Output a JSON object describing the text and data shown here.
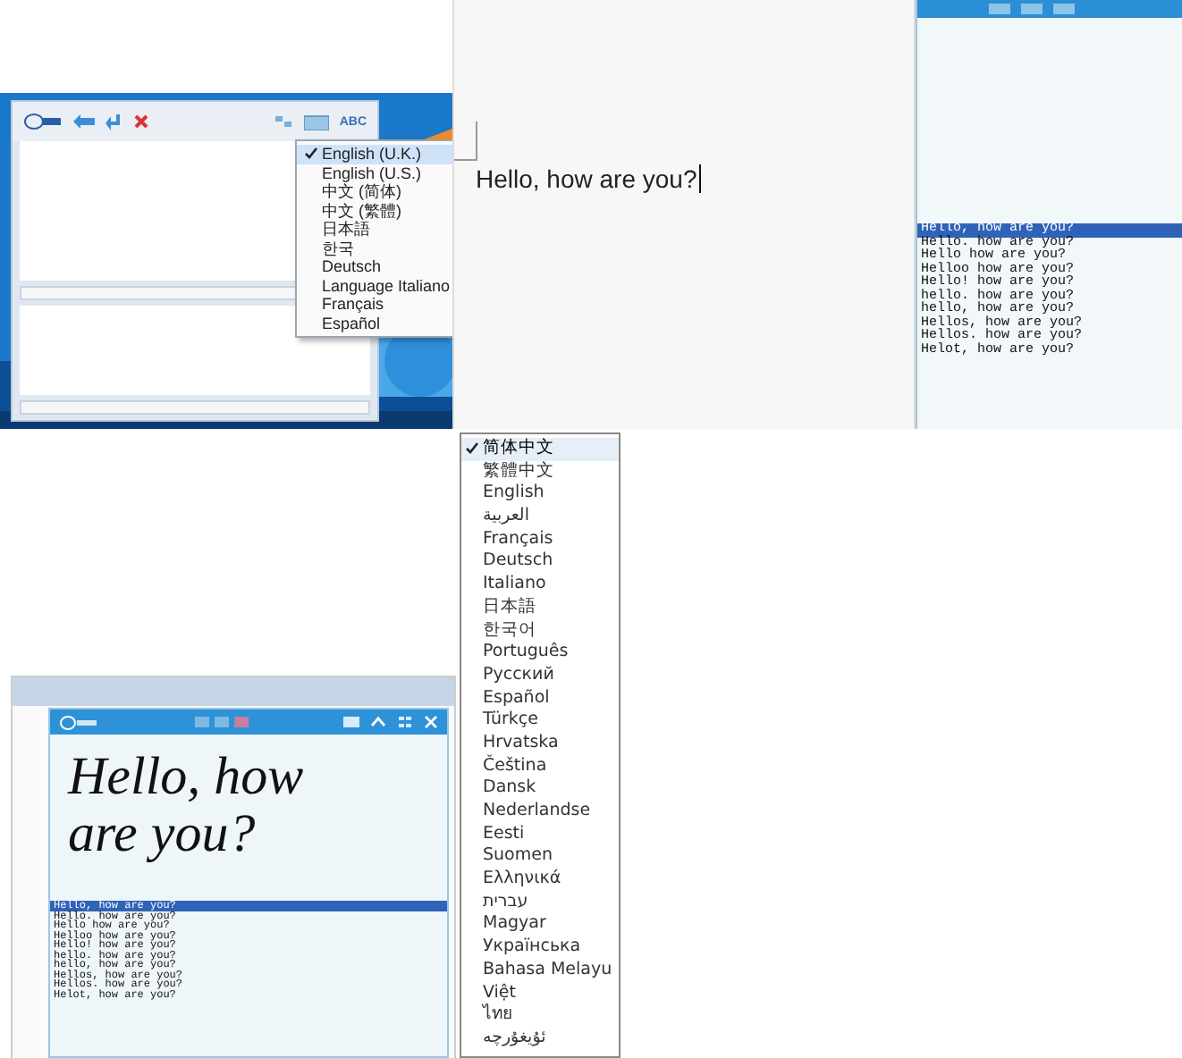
{
  "desktop_app": {
    "toolbar_label": "ABC",
    "language_menu": [
      {
        "label": "English (U.K.)",
        "selected": true
      },
      {
        "label": "English (U.S.)",
        "selected": false
      },
      {
        "label": "中文 (简体)",
        "selected": false
      },
      {
        "label": "中文 (繁體)",
        "selected": false
      },
      {
        "label": "日本語",
        "selected": false
      },
      {
        "label": "한국",
        "selected": false
      },
      {
        "label": "Deutsch",
        "selected": false
      },
      {
        "label": "Language Italiano",
        "selected": false
      },
      {
        "label": "Français",
        "selected": false
      },
      {
        "label": "Español",
        "selected": false
      }
    ]
  },
  "document": {
    "text": "Hello, how are you?"
  },
  "side_app": {
    "candidates": [
      {
        "text": "Hello, how are you?",
        "selected": true
      },
      {
        "text": "Hello. how are you?",
        "selected": false
      },
      {
        "text": "Hello how are you?",
        "selected": false
      },
      {
        "text": "Helloo how are you?",
        "selected": false
      },
      {
        "text": "Hello! how are you?",
        "selected": false
      },
      {
        "text": "hello. how are you?",
        "selected": false
      },
      {
        "text": "hello, how are you?",
        "selected": false
      },
      {
        "text": "Hellos, how are you?",
        "selected": false
      },
      {
        "text": "Hellos. how are you?",
        "selected": false
      },
      {
        "text": "Helot, how are you?",
        "selected": false
      }
    ]
  },
  "handwriting_app": {
    "ink": "Hello, how are you?",
    "candidates": [
      {
        "text": "Hello, how are you?",
        "selected": true
      },
      {
        "text": "Hello. how are you?",
        "selected": false
      },
      {
        "text": "Hello how are you?",
        "selected": false
      },
      {
        "text": "Helloo how are you?",
        "selected": false
      },
      {
        "text": "Hello! how are you?",
        "selected": false
      },
      {
        "text": "hello. how are you?",
        "selected": false
      },
      {
        "text": "hello, how are you?",
        "selected": false
      },
      {
        "text": "Hellos, how are you?",
        "selected": false
      },
      {
        "text": "Hellos. how are you?",
        "selected": false
      },
      {
        "text": "Helot, how are you?",
        "selected": false
      }
    ]
  },
  "language_menu": {
    "items": [
      {
        "label": "简体中文",
        "selected": true
      },
      {
        "label": "繁體中文",
        "selected": false
      },
      {
        "label": "English",
        "selected": false
      },
      {
        "label": "العربية",
        "selected": false
      },
      {
        "label": "Français",
        "selected": false
      },
      {
        "label": "Deutsch",
        "selected": false
      },
      {
        "label": "Italiano",
        "selected": false
      },
      {
        "label": "日本語",
        "selected": false
      },
      {
        "label": "한국어",
        "selected": false
      },
      {
        "label": "Português",
        "selected": false
      },
      {
        "label": "Русский",
        "selected": false
      },
      {
        "label": "Español",
        "selected": false
      },
      {
        "label": "Türkçe",
        "selected": false
      },
      {
        "label": "Hrvatska",
        "selected": false
      },
      {
        "label": "Čeština",
        "selected": false
      },
      {
        "label": "Dansk",
        "selected": false
      },
      {
        "label": "Nederlandse",
        "selected": false
      },
      {
        "label": "Eesti",
        "selected": false
      },
      {
        "label": "Suomen",
        "selected": false
      },
      {
        "label": "Ελληνικά",
        "selected": false
      },
      {
        "label": "עברית",
        "selected": false
      },
      {
        "label": "Magyar",
        "selected": false
      },
      {
        "label": "Українська",
        "selected": false
      },
      {
        "label": "Bahasa Melayu",
        "selected": false
      },
      {
        "label": "Việt",
        "selected": false
      },
      {
        "label": "ไทย",
        "selected": false
      },
      {
        "label": "ئۇيغۇرچە",
        "selected": false
      }
    ]
  }
}
